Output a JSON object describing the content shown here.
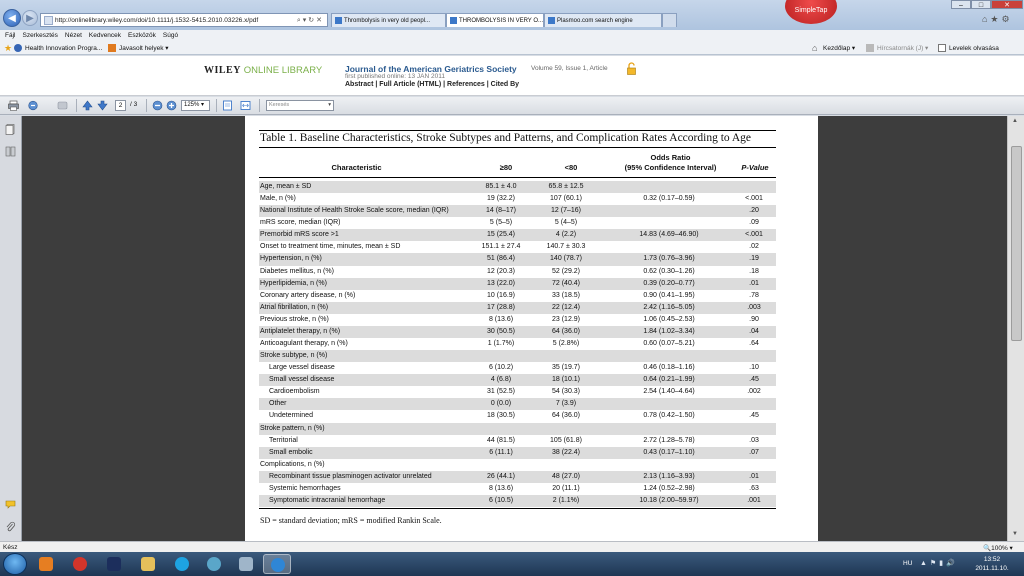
{
  "browser": {
    "url": "http://onlinelibrary.wiley.com/doi/10.1111/j.1532-5415.2010.03226.x/pdf",
    "tabs": [
      {
        "label": "Thrombolysis in very old peopl..."
      },
      {
        "label": "THROMBOLYSIS IN VERY O..."
      },
      {
        "label": "Plasmoo.com search engine"
      }
    ],
    "simpletap_label": "SimpleTap",
    "menu": [
      "Fájl",
      "Szerkesztés",
      "Nézet",
      "Kedvencek",
      "Eszközök",
      "Súgó"
    ],
    "favorites": {
      "health": "Health Innovation Progra...",
      "suggested": "Javasolt helyek",
      "home": "Kezdőlap",
      "feeds": "Hírcsatornák (J)",
      "mail": "Levelek olvasása"
    }
  },
  "wiley": {
    "logo_wiley": "WILEY",
    "logo_olib": "ONLINE LIBRARY",
    "journal": "Journal of the American Geriatrics Society",
    "volume": "Volume 59, Issue 1, Article",
    "first_published": "first published online: 13 JAN 2011",
    "links": "Abstract | Full Article (HTML) | References | Cited By"
  },
  "pdf_toolbar": {
    "page": "2",
    "page_total": "/ 3",
    "zoom": "125%",
    "search_placeholder": "Keresés"
  },
  "table": {
    "title": "Table 1.  Baseline Characteristics, Stroke Subtypes and Patterns, and Complication Rates According to Age",
    "headers": {
      "characteristic": "Characteristic",
      "ge80": "≥80",
      "lt80": "<80",
      "or_line1": "Odds Ratio",
      "or_line2": "(95% Confidence Interval)",
      "p": "P-Value"
    },
    "rows": [
      {
        "label": "Age, mean ± SD",
        "ge80": "85.1 ± 4.0",
        "lt80": "65.8 ± 12.5",
        "or": "",
        "p": "",
        "indent": false
      },
      {
        "label": "Male, n (%)",
        "ge80": "19 (32.2)",
        "lt80": "107 (60.1)",
        "or": "0.32 (0.17–0.59)",
        "p": "<.001",
        "indent": false
      },
      {
        "label": "National Institute of Health Stroke Scale score, median (IQR)",
        "ge80": "14 (8–17)",
        "lt80": "12 (7–16)",
        "or": "",
        "p": ".20",
        "indent": false
      },
      {
        "label": "mRS score, median (IQR)",
        "ge80": "5 (5–5)",
        "lt80": "5 (4–5)",
        "or": "",
        "p": ".09",
        "indent": false
      },
      {
        "label": "Premorbid mRS score >1",
        "ge80": "15 (25.4)",
        "lt80": "4 (2.2)",
        "or": "14.83 (4.69–46.90)",
        "p": "<.001",
        "indent": false
      },
      {
        "label": "Onset to treatment time, minutes, mean ± SD",
        "ge80": "151.1 ± 27.4",
        "lt80": "140.7 ± 30.3",
        "or": "",
        "p": ".02",
        "indent": false
      },
      {
        "label": "Hypertension, n (%)",
        "ge80": "51 (86.4)",
        "lt80": "140 (78.7)",
        "or": "1.73 (0.76–3.96)",
        "p": ".19",
        "indent": false
      },
      {
        "label": "Diabetes mellitus, n (%)",
        "ge80": "12 (20.3)",
        "lt80": "52 (29.2)",
        "or": "0.62 (0.30–1.26)",
        "p": ".18",
        "indent": false
      },
      {
        "label": "Hyperlipidemia, n (%)",
        "ge80": "13 (22.0)",
        "lt80": "72 (40.4)",
        "or": "0.39 (0.20–0.77)",
        "p": ".01",
        "indent": false
      },
      {
        "label": "Coronary artery disease, n (%)",
        "ge80": "10 (16.9)",
        "lt80": "33 (18.5)",
        "or": "0.90 (0.41–1.95)",
        "p": ".78",
        "indent": false
      },
      {
        "label": "Atrial fibrillation, n (%)",
        "ge80": "17 (28.8)",
        "lt80": "22 (12.4)",
        "or": "2.42 (1.16–5.05)",
        "p": ".003",
        "indent": false
      },
      {
        "label": "Previous stroke, n (%)",
        "ge80": "8 (13.6)",
        "lt80": "23 (12.9)",
        "or": "1.06 (0.45–2.53)",
        "p": ".90",
        "indent": false
      },
      {
        "label": "Antiplatelet therapy, n (%)",
        "ge80": "30 (50.5)",
        "lt80": "64 (36.0)",
        "or": "1.84 (1.02–3.34)",
        "p": ".04",
        "indent": false
      },
      {
        "label": "Anticoagulant therapy, n (%)",
        "ge80": "1 (1.7%)",
        "lt80": "5 (2.8%)",
        "or": "0.60 (0.07–5.21)",
        "p": ".64",
        "indent": false
      },
      {
        "label": "Stroke subtype, n (%)",
        "ge80": "",
        "lt80": "",
        "or": "",
        "p": "",
        "indent": false
      },
      {
        "label": "Large vessel disease",
        "ge80": "6 (10.2)",
        "lt80": "35 (19.7)",
        "or": "0.46 (0.18–1.16)",
        "p": ".10",
        "indent": true
      },
      {
        "label": "Small vessel disease",
        "ge80": "4 (6.8)",
        "lt80": "18 (10.1)",
        "or": "0.64 (0.21–1.99)",
        "p": ".45",
        "indent": true
      },
      {
        "label": "Cardioembolism",
        "ge80": "31 (52.5)",
        "lt80": "54 (30.3)",
        "or": "2.54 (1.40–4.64)",
        "p": ".002",
        "indent": true
      },
      {
        "label": "Other",
        "ge80": "0 (0.0)",
        "lt80": "7 (3.9)",
        "or": "",
        "p": "",
        "indent": true
      },
      {
        "label": "Undetermined",
        "ge80": "18 (30.5)",
        "lt80": "64 (36.0)",
        "or": "0.78 (0.42–1.50)",
        "p": ".45",
        "indent": true
      },
      {
        "label": "Stroke pattern, n (%)",
        "ge80": "",
        "lt80": "",
        "or": "",
        "p": "",
        "indent": false
      },
      {
        "label": "Territorial",
        "ge80": "44 (81.5)",
        "lt80": "105 (61.8)",
        "or": "2.72 (1.28–5.78)",
        "p": ".03",
        "indent": true
      },
      {
        "label": "Small embolic",
        "ge80": "6 (11.1)",
        "lt80": "38 (22.4)",
        "or": "0.43 (0.17–1.10)",
        "p": ".07",
        "indent": true
      },
      {
        "label": "Complications, n (%)",
        "ge80": "",
        "lt80": "",
        "or": "",
        "p": "",
        "indent": false
      },
      {
        "label": "Recombinant tissue plasminogen activator unrelated",
        "ge80": "26 (44.1)",
        "lt80": "48 (27.0)",
        "or": "2.13 (1.16–3.93)",
        "p": ".01",
        "indent": true
      },
      {
        "label": "Systemic hemorrhages",
        "ge80": "8 (13.6)",
        "lt80": "20 (11.1)",
        "or": "1.24 (0.52–2.98)",
        "p": ".63",
        "indent": true
      },
      {
        "label": "Symptomatic intracranial hemorrhage",
        "ge80": "6 (10.5)",
        "lt80": "2 (1.1%)",
        "or": "10.18 (2.00–59.97)",
        "p": ".001",
        "indent": true
      }
    ],
    "footnote": "SD = standard deviation; mRS = modified Rankin Scale."
  },
  "status": {
    "text": "Kész",
    "zoom": "100%"
  },
  "taskbar": {
    "lang": "HU",
    "time": "13:52",
    "date": "2011.11.10."
  },
  "colors": {
    "row_shade": "#dcdcdc",
    "journal_blue": "#2a5a8f",
    "wiley_green": "#7bb04a",
    "pdf_background": "#3d3d3d"
  }
}
